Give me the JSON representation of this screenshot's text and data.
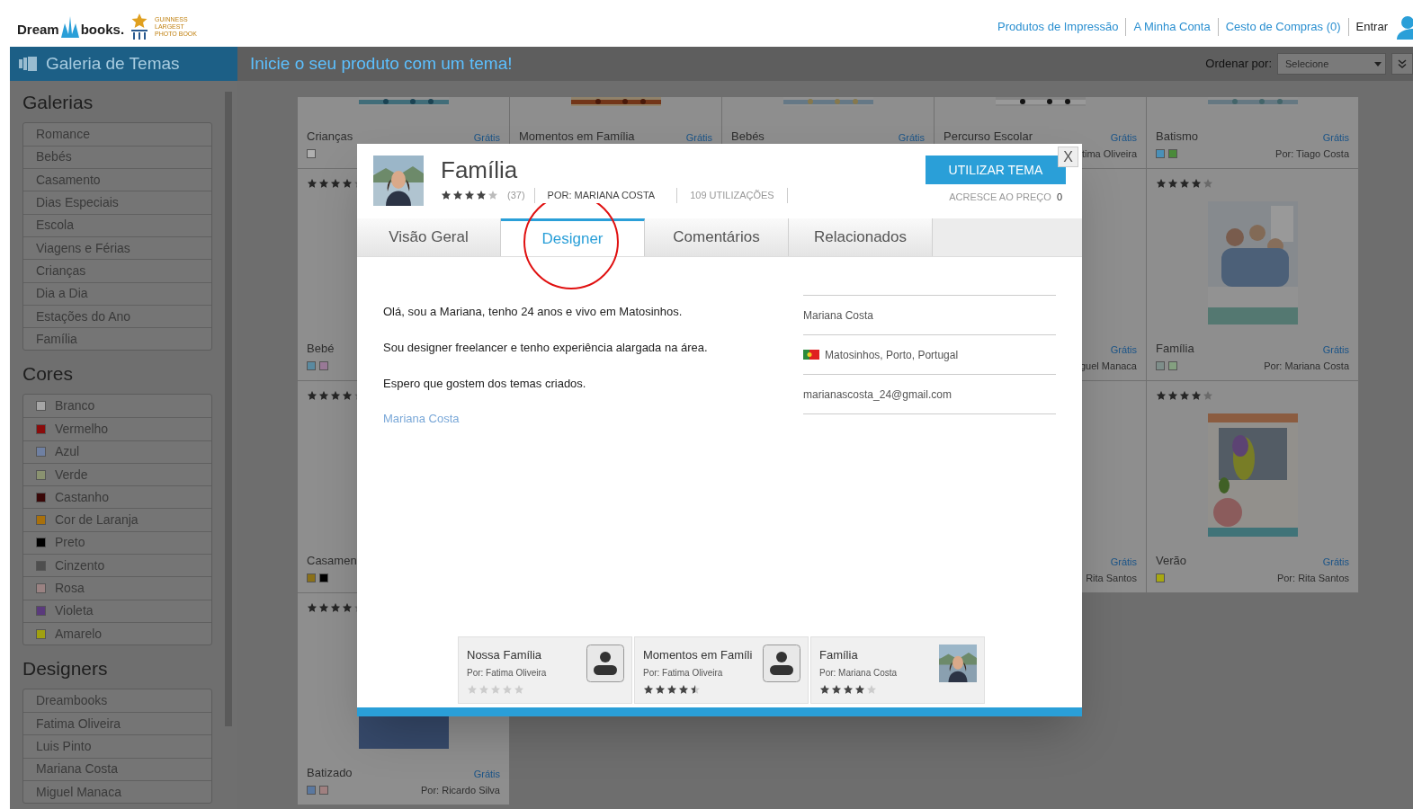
{
  "header": {
    "logo_words": [
      "Dream",
      "books."
    ],
    "badge_lines": [
      "GUINNESS",
      "LARGEST",
      "PHOTO BOOK"
    ],
    "links": [
      "Produtos de Impressão",
      "A Minha Conta",
      "Cesto de Compras (0)"
    ],
    "login": "Entrar"
  },
  "sidebar": {
    "title": "Galeria de Temas",
    "sections": [
      {
        "title": "Galerias",
        "kind": "plain",
        "items": [
          {
            "label": "Romance"
          },
          {
            "label": "Bebés"
          },
          {
            "label": "Casamento"
          },
          {
            "label": "Dias Especiais"
          },
          {
            "label": "Escola"
          },
          {
            "label": "Viagens e Férias"
          },
          {
            "label": "Crianças"
          },
          {
            "label": "Dia a Dia"
          },
          {
            "label": "Estações do Ano"
          },
          {
            "label": "Família"
          }
        ]
      },
      {
        "title": "Cores",
        "kind": "color",
        "items": [
          {
            "label": "Branco",
            "color": "#a6a6a6"
          },
          {
            "label": "Vermelho",
            "color": "#8a0c0c"
          },
          {
            "label": "Azul",
            "color": "#6f80a2"
          },
          {
            "label": "Verde",
            "color": "#8a9270"
          },
          {
            "label": "Castanho",
            "color": "#3a0808"
          },
          {
            "label": "Cor de Laranja",
            "color": "#a8700c"
          },
          {
            "label": "Preto",
            "color": "#000000"
          },
          {
            "label": "Cinzento",
            "color": "#4e4e4e"
          },
          {
            "label": "Rosa",
            "color": "#9a8282"
          },
          {
            "label": "Violeta",
            "color": "#5a3a7c"
          },
          {
            "label": "Amarelo",
            "color": "#a0a010"
          }
        ]
      },
      {
        "title": "Designers",
        "kind": "plain",
        "items": [
          {
            "label": "Dreambooks"
          },
          {
            "label": "Fatima Oliveira"
          },
          {
            "label": "Luis Pinto"
          },
          {
            "label": "Mariana Costa"
          },
          {
            "label": "Miguel Manaca"
          }
        ]
      }
    ]
  },
  "toolbar": {
    "headline": "Inicie o seu produto com um tema!",
    "sort_label": "Ordenar por:",
    "sort_value": "Selecione"
  },
  "gallery": {
    "columns": [
      [
        {
          "title": "Crianças",
          "price": "Grátis",
          "kind": "picture",
          "swatches": [
            {
              "color": "#b0b0b0"
            }
          ]
        },
        {
          "title": "Bebé",
          "stars": 4,
          "swatches": [
            {
              "color": "#5a8aa0"
            },
            {
              "color": "#9a7a98"
            }
          ]
        },
        {
          "title": "Casamen",
          "stars": 4,
          "swatches": [
            {
              "color": "#8a7018"
            },
            {
              "color": "#000000"
            }
          ]
        },
        {
          "title": "Batizado",
          "price": "Grátis",
          "kind": "picture",
          "author": "Por: Ricardo Silva",
          "stars": 4,
          "swatches": [
            {
              "color": "#5a78a0"
            },
            {
              "color": "#a08080"
            }
          ]
        }
      ],
      [
        {
          "title": "Momentos em Família",
          "price": "Grátis",
          "kind": "picture"
        }
      ],
      [
        {
          "title": "Bebés",
          "price": "Grátis",
          "kind": "picture"
        }
      ],
      [
        {
          "title": "Percurso Escolar",
          "price": "Grátis",
          "kind": "picture",
          "author": "tima Oliveira"
        },
        {
          "price": "Grátis",
          "author": "guel Manaca"
        },
        {
          "price": "Grátis",
          "author": "Rita Santos"
        }
      ],
      [
        {
          "title": "Batismo",
          "price": "Grátis",
          "kind": "picture",
          "author": "Por: Tiago Costa",
          "swatches": [
            {
              "color": "#4a90b8"
            },
            {
              "color": "#4a8a3a"
            }
          ]
        },
        {
          "title": "Família",
          "price": "Grátis",
          "kind": "picture",
          "author": "Por: Mariana Costa",
          "stars": 4,
          "swatches": [
            {
              "color": "#7e8e8a"
            },
            {
              "color": "#84a080"
            }
          ]
        },
        {
          "title": "Verão",
          "price": "Grátis",
          "kind": "picture",
          "author": "Por: Rita Santos",
          "stars": 4,
          "swatches": [
            {
              "color": "#a8a810"
            }
          ]
        }
      ]
    ]
  },
  "modal": {
    "title": "Família",
    "stars": 4,
    "rating_count": "(37)",
    "author": "POR: MARIANA COSTA",
    "uses": "109 UTILIZAÇÕES",
    "button": "UTILIZAR TEMA",
    "surcharge_label": "ACRESCE AO PREÇO",
    "surcharge": "0",
    "close": "X",
    "tabs": [
      {
        "label": "Visão Geral",
        "selected": false
      },
      {
        "label": "Designer",
        "selected": true
      },
      {
        "label": "Comentários",
        "selected": false
      },
      {
        "label": "Relacionados",
        "selected": false
      }
    ],
    "bio": [
      "Olá, sou a Mariana, tenho 24 anos e vivo em Matosinhos.",
      "Sou designer freelancer e tenho experiência alargada na área.",
      "Espero que gostem dos temas criados."
    ],
    "signature": "Mariana Costa",
    "info": [
      {
        "kind": "text",
        "text": "Mariana Costa"
      },
      {
        "kind": "location",
        "text": "Matosinhos, Porto, Portugal"
      },
      {
        "kind": "text",
        "text": "marianascosta_24@gmail.com"
      }
    ],
    "related": [
      {
        "title": "Nossa Família",
        "author": "Por: Fatima Oliveira",
        "stars": 0,
        "kind": "placeholder"
      },
      {
        "title": "Momentos em Famíli",
        "author": "Por: Fatima Oliveira",
        "stars": 4.5,
        "kind": "placeholder"
      },
      {
        "title": "Família",
        "author": "Por: Mariana Costa",
        "stars": 4
      }
    ]
  }
}
